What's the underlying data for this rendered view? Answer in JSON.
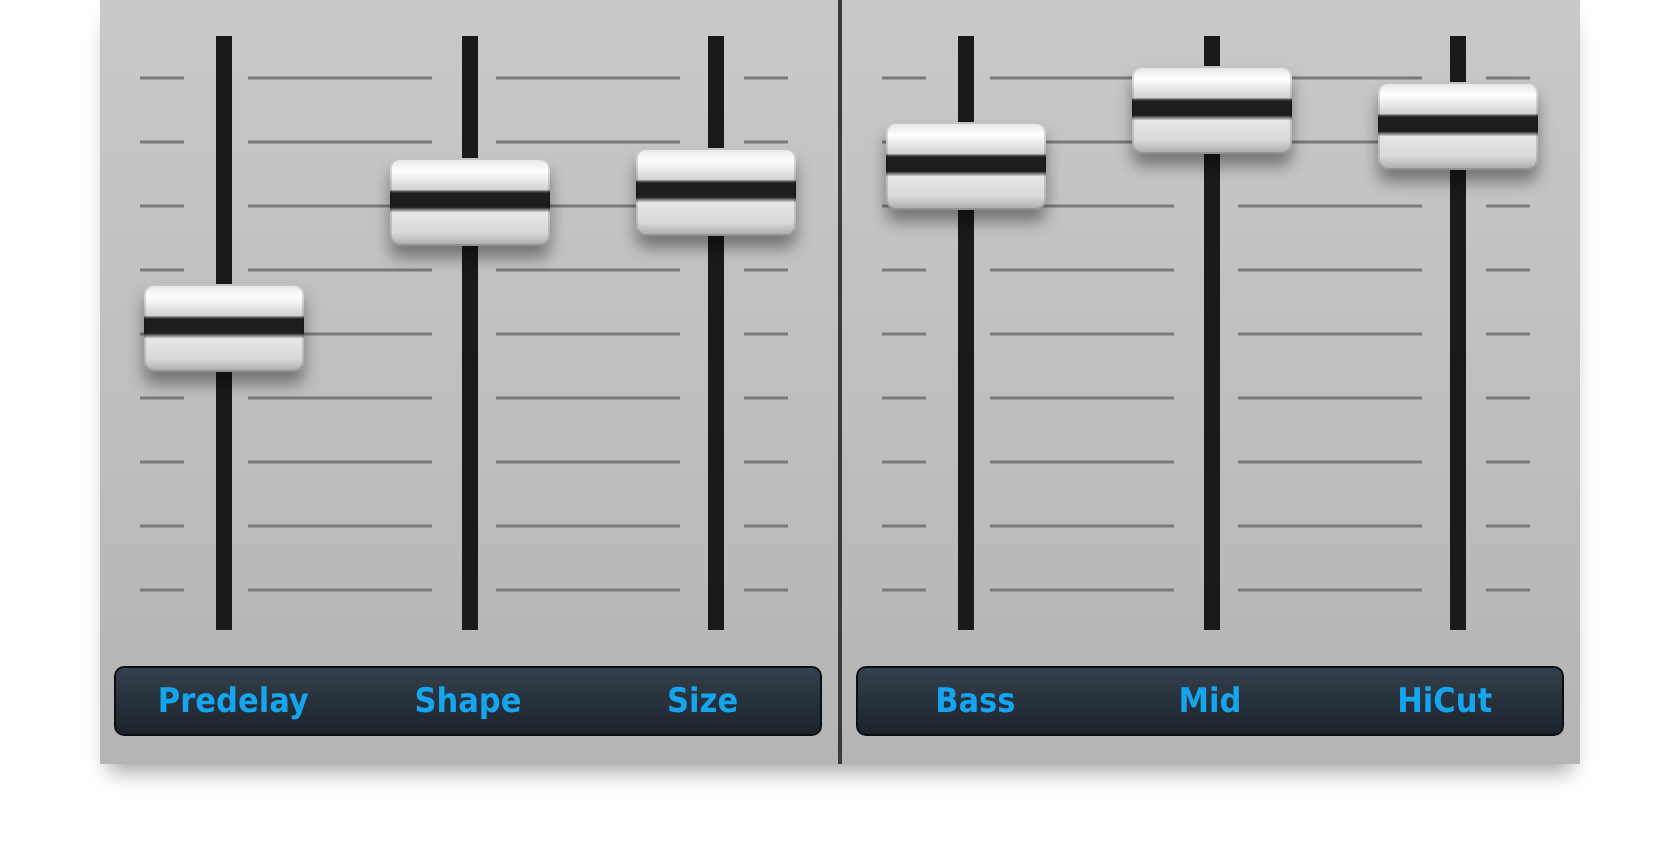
{
  "groups": [
    {
      "faders": [
        {
          "label": "Predelay",
          "level": 0.51
        },
        {
          "label": "Shape",
          "level": 0.76
        },
        {
          "label": "Size",
          "level": 0.78
        }
      ]
    },
    {
      "faders": [
        {
          "label": "Bass",
          "level": 0.83
        },
        {
          "label": "Mid",
          "level": 0.94
        },
        {
          "label": "HiCut",
          "level": 0.91
        }
      ]
    }
  ]
}
